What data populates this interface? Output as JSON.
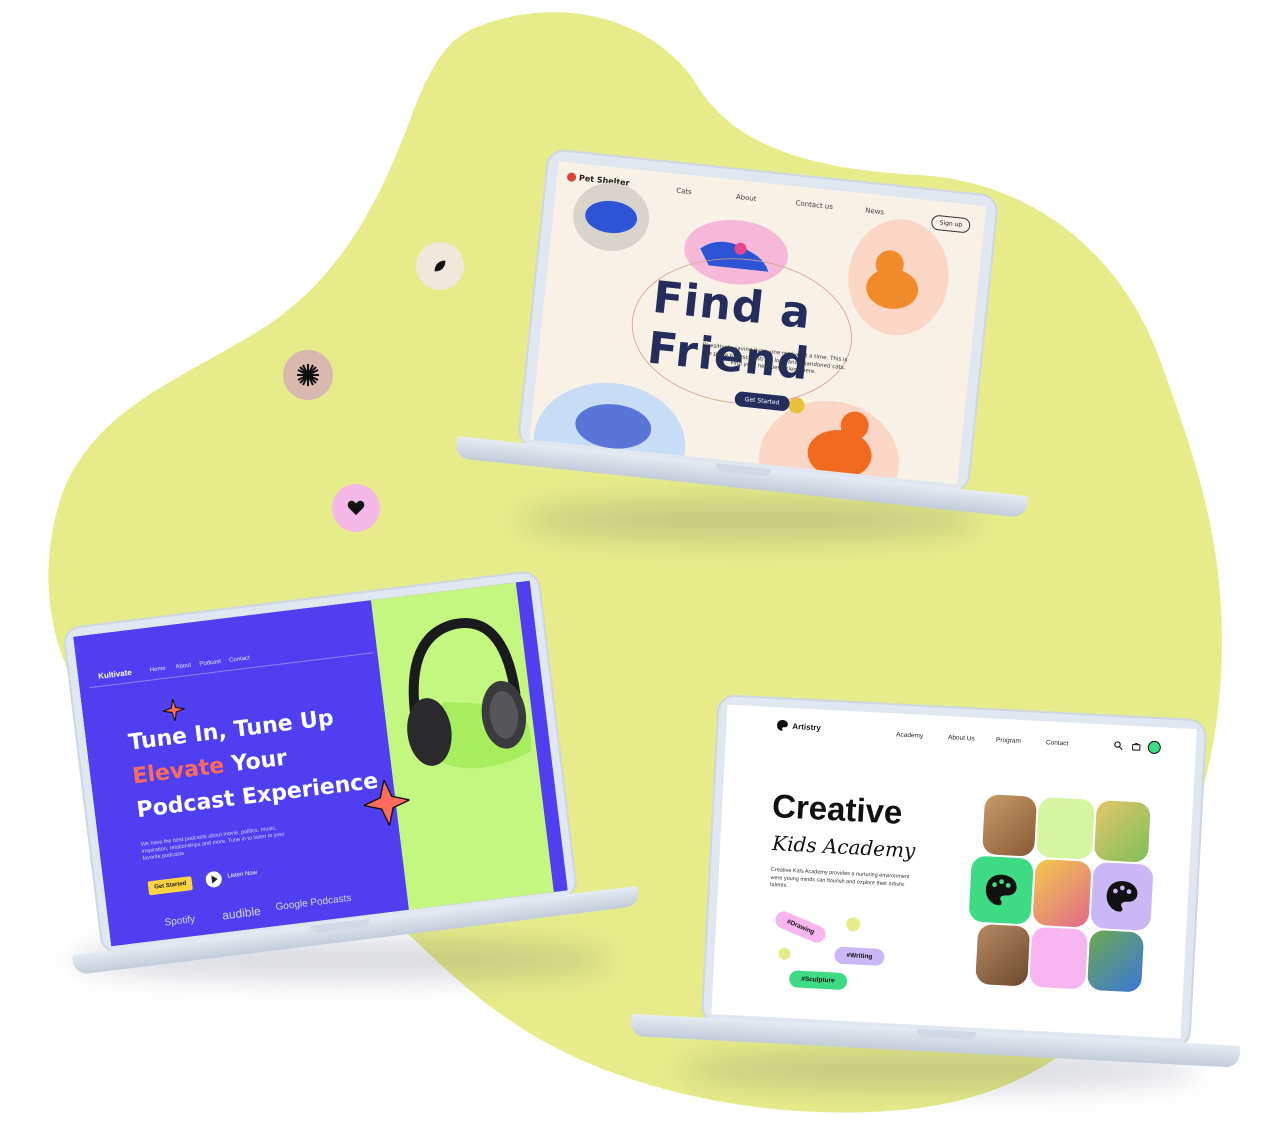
{
  "pet_shelter": {
    "logo": "Pet Shelter",
    "nav": [
      "Cats",
      "About",
      "Contact us",
      "News"
    ],
    "signup": "Sign up",
    "headline": "Find a Friend",
    "subtext": "Pawsitively saving lives, one rescue at a time. This is the place to rescue stray, lost, and abandoned cats. Find your new best friend here.",
    "cta": "Get Started"
  },
  "podcast": {
    "brand": "Kultivate",
    "nav": [
      "Home",
      "About",
      "Podcast",
      "Contact"
    ],
    "headline_line1": "Tune In, Tune Up",
    "headline_highlight": "Elevate",
    "headline_line2_rest": " Your",
    "headline_line3": "Podcast Experience",
    "description": "We have the best podcasts about movie, politics, music, inspiration, relationships and more. Tune in to listen to your favorite podcasts",
    "cta": "Get Started",
    "listen": "Listen Now",
    "partners": [
      "Spotify",
      "audible",
      "Google Podcasts"
    ]
  },
  "artistry": {
    "brand": "Artistry",
    "nav": [
      "Academy",
      "About Us",
      "Program",
      "Contact"
    ],
    "headline": "Creative",
    "subheadline": "Kids Academy",
    "description": "Creative Kids Academy provides a nurturing environment were young minds can flourish and explore their artistic talents.",
    "tags": [
      "#Drawing",
      "#Writing",
      "#Sculpture"
    ]
  },
  "colors": {
    "blob": "#e6ec8a",
    "podcast_bg": "#4f3ff0",
    "podcast_accent": "#c4f77f",
    "pet_navy": "#252d5c",
    "art_green": "#3ddc84",
    "art_pink": "#f7b6f0",
    "art_lilac": "#c9b8f5"
  },
  "icons": [
    "leaf-icon",
    "sparkle-icon",
    "heart-icon",
    "search-icon",
    "bag-icon",
    "palette-icon",
    "star-icon"
  ]
}
